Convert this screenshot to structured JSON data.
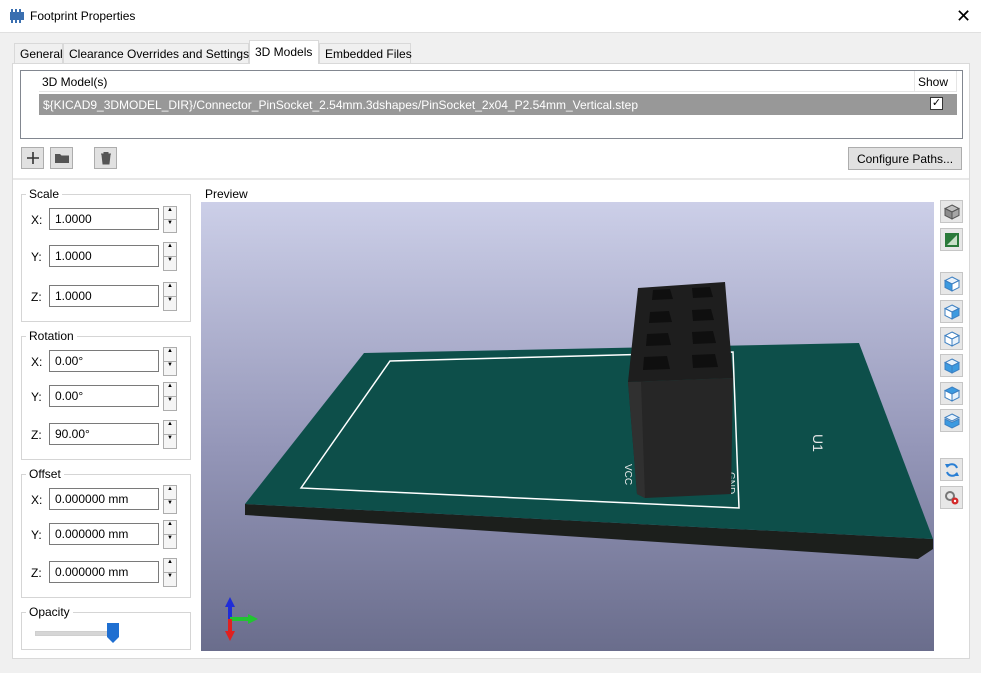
{
  "window": {
    "title": "Footprint Properties",
    "close_glyph": "✕"
  },
  "tabs": [
    {
      "label": "General",
      "active": false
    },
    {
      "label": "Clearance Overrides and Settings",
      "active": false
    },
    {
      "label": "3D Models",
      "active": true
    },
    {
      "label": "Embedded Files",
      "active": false
    }
  ],
  "model_list": {
    "columns": [
      "3D Model(s)",
      "Show"
    ],
    "rows": [
      {
        "path": "${KICAD9_3DMODEL_DIR}/Connector_PinSocket_2.54mm.3dshapes/PinSocket_2x04_P2.54mm_Vertical.step",
        "show": true
      }
    ]
  },
  "toolbar": {
    "add_icon": "plus-icon",
    "browse_icon": "folder-icon",
    "delete_icon": "trash-icon",
    "configure_label": "Configure Paths..."
  },
  "scale": {
    "label": "Scale",
    "x_label": "X:",
    "y_label": "Y:",
    "z_label": "Z:",
    "x": "1.0000",
    "y": "1.0000",
    "z": "1.0000"
  },
  "rotation": {
    "label": "Rotation",
    "x_label": "X:",
    "y_label": "Y:",
    "z_label": "Z:",
    "x": "0.00°",
    "y": "0.00°",
    "z": "90.00°"
  },
  "offset": {
    "label": "Offset",
    "x_label": "X:",
    "y_label": "Y:",
    "z_label": "Z:",
    "x": "0.000000 mm",
    "y": "0.000000 mm",
    "z": "0.000000 mm"
  },
  "opacity": {
    "label": "Opacity",
    "value": 0.95
  },
  "preview": {
    "label": "Preview",
    "silkscreen_ref": "U1",
    "silkscreen_pins": [
      "VCC",
      "GND"
    ],
    "board_color": "#0d4f4a",
    "connector_color": "#2b2b2b"
  },
  "view_buttons": [
    "view-3d-icon",
    "material-icon",
    "view-left-icon",
    "view-right-icon",
    "view-front-icon",
    "view-back-icon",
    "view-top-icon",
    "view-bottom-icon",
    "reload-icon",
    "settings-icon"
  ]
}
